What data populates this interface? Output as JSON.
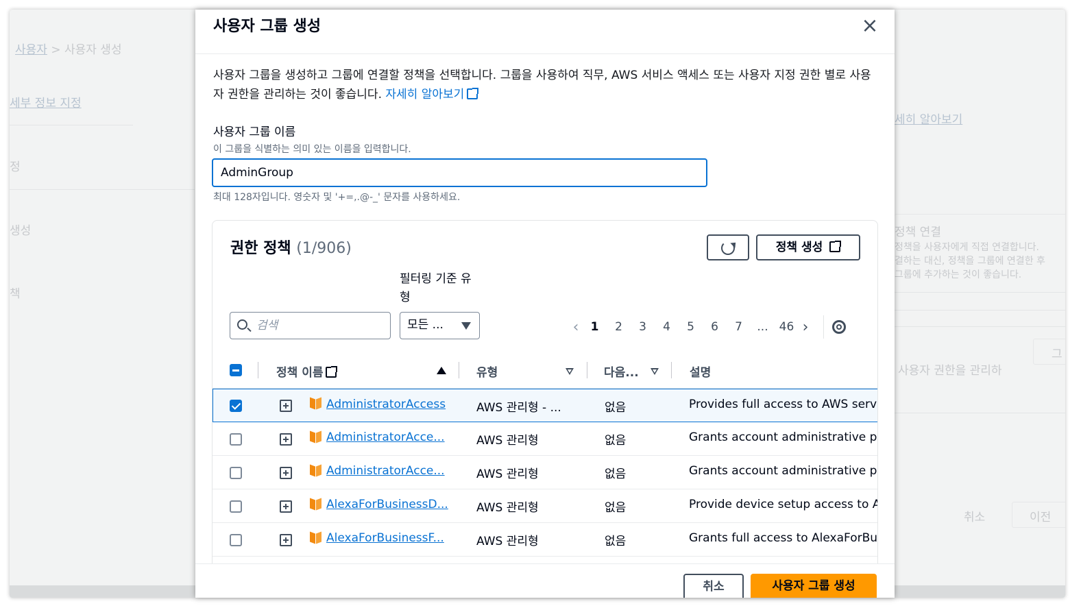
{
  "background": {
    "breadcrumb": [
      "사용자",
      "사용자 생성"
    ],
    "steps": [
      "세부 정보 지정",
      "정",
      "생성",
      "책"
    ],
    "learn_more": "세히 알아보기",
    "right_heading": "정책 연결",
    "right_text": [
      "정책을 사용자에게 직접 연결합니다.",
      "결하는 대신, 정책을 그룹에 연결한 후",
      "그룹에 추가하는 것이 좋습니다."
    ],
    "right_mid": "사용자 권한을 관리하",
    "right_btn": "그",
    "cancel": "취소",
    "prev": "이전"
  },
  "modal": {
    "title": "사용자 그룹 생성",
    "description": "사용자 그룹을 생성하고 그룹에 연결할 정책을 선택합니다. 그룹을 사용하여 직무, AWS 서비스 액세스 또는 사용자 지정 권한 별로 사용자 권한을 관리하는 것이 좋습니다.",
    "learn_more": "자세히 알아보기",
    "group_name_label": "사용자 그룹 이름",
    "group_name_sublabel": "이 그룹을 식별하는 의미 있는 이름을 입력합니다.",
    "group_name_value": "AdminGroup",
    "group_name_hint": "최대 128자입니다. 영숫자 및 '+=,.@-_' 문자를 사용하세요.",
    "cancel_label": "취소",
    "create_label": "사용자 그룹 생성"
  },
  "policies": {
    "title": "권한 정책",
    "count": "(1/906)",
    "create_policy_label": "정책 생성",
    "filter_label": "필터링 기준 유형",
    "search_placeholder": "검색",
    "filter_value": "모든 ...",
    "pages": [
      "1",
      "2",
      "3",
      "4",
      "5",
      "6",
      "7",
      "...",
      "46"
    ],
    "current_page": "1",
    "columns": {
      "name": "정책 이름",
      "type": "유형",
      "used_as": "다음...",
      "description": "설명"
    },
    "rows": [
      {
        "name": "AdministratorAccess",
        "type": "AWS 관리형 - ...",
        "used_as": "없음",
        "description": "Provides full access to AWS services",
        "checked": true
      },
      {
        "name": "AdministratorAcce...",
        "type": "AWS 관리형",
        "used_as": "없음",
        "description": "Grants account administrative perm",
        "checked": false
      },
      {
        "name": "AdministratorAcce...",
        "type": "AWS 관리형",
        "used_as": "없음",
        "description": "Grants account administrative perm",
        "checked": false
      },
      {
        "name": "AlexaForBusinessD...",
        "type": "AWS 관리형",
        "used_as": "없음",
        "description": "Provide device setup access to Alex",
        "checked": false
      },
      {
        "name": "AlexaForBusinessF...",
        "type": "AWS 관리형",
        "used_as": "없음",
        "description": "Grants full access to AlexaForBusin",
        "checked": false
      }
    ]
  },
  "colors": {
    "accent": "#0972d3",
    "primary_button": "#ff9900",
    "aws_icon": "#f28a10"
  }
}
